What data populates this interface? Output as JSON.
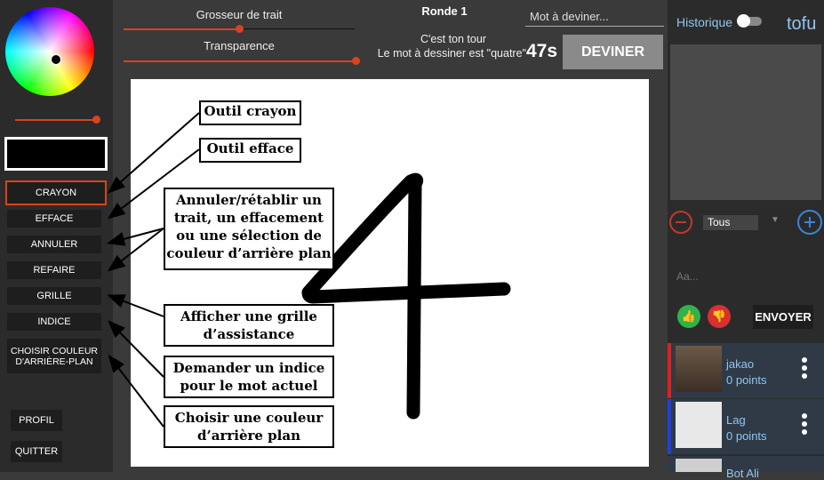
{
  "colors": {
    "accent": "#d9431e",
    "panel": "#2b2b2b",
    "link_blue": "#8fc6f2"
  },
  "left_panel": {
    "tools": [
      "CRAYON",
      "EFFACE",
      "ANNULER",
      "REFAIRE",
      "GRILLE",
      "INDICE"
    ],
    "bg_color_button": "CHOISIR COULEUR D'ARRIÈRE-PLAN",
    "profile_button": "PROFIL",
    "quit_button": "QUITTER"
  },
  "top_bar": {
    "stroke_size_label": "Grosseur de trait",
    "transparency_label": "Transparence",
    "round_label": "Ronde 1",
    "guess_placeholder": "Mot à deviner...",
    "turn_message": "C'est ton tour",
    "word_message": "Le mot à dessiner est \"quatre\"",
    "timer": "47s",
    "guess_button": "DEVINER"
  },
  "canvas": {
    "drawn_glyph": "4"
  },
  "annotations": {
    "pencil": "Outil crayon",
    "eraser": "Outil efface",
    "undo_redo": "Annuler/rétablir un trait, un effacement ou une sélection de couleur d’arrière plan",
    "grid": "Afficher une grille d’assistance",
    "hint": "Demander un indice pour le mot actuel",
    "bg_color": "Choisir une couleur d’arrière plan"
  },
  "right_panel": {
    "history_label": "Historique",
    "username": "tofu",
    "filter_value": "Tous",
    "chat_placeholder": "Aa...",
    "send_button": "ENVOYER",
    "players": [
      {
        "name": "jakao",
        "points": "0 points",
        "color": "#e02020"
      },
      {
        "name": "Lag",
        "points": "0 points",
        "color": "#2040e0"
      },
      {
        "name": "Bot Ali",
        "points": "",
        "color": "#2b2b2b"
      }
    ]
  }
}
